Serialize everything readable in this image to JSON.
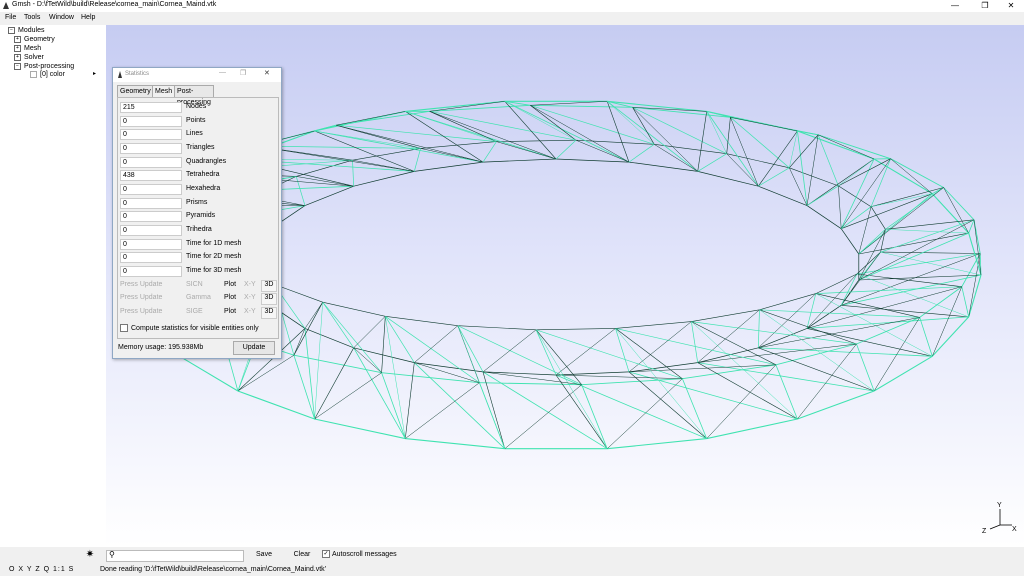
{
  "window": {
    "title": "Gmsh - D:\\fTetWild\\build\\Release\\cornea_main\\Cornea_Maind.vtk",
    "minimize": "—",
    "maximize": "❐",
    "close": "✕"
  },
  "menu": [
    "File",
    "Tools",
    "Window",
    "Help"
  ],
  "tree": {
    "root": "Modules",
    "items": [
      "Geometry",
      "Mesh",
      "Solver",
      "Post-processing"
    ],
    "sub": "[0] color"
  },
  "axes": {
    "x": "X",
    "y": "Y",
    "z": "Z"
  },
  "stats_dialog": {
    "title": "Statistics",
    "tabs": [
      "Geometry",
      "Mesh",
      "Post-processing"
    ],
    "active_tab": "Mesh",
    "rows": [
      {
        "value": "215",
        "label": "Nodes"
      },
      {
        "value": "0",
        "label": "Points"
      },
      {
        "value": "0",
        "label": "Lines"
      },
      {
        "value": "0",
        "label": "Triangles"
      },
      {
        "value": "0",
        "label": "Quadrangles"
      },
      {
        "value": "438",
        "label": "Tetrahedra"
      },
      {
        "value": "0",
        "label": "Hexahedra"
      },
      {
        "value": "0",
        "label": "Prisms"
      },
      {
        "value": "0",
        "label": "Pyramids"
      },
      {
        "value": "0",
        "label": "Trihedra"
      },
      {
        "value": "0",
        "label": "Time for 1D mesh"
      },
      {
        "value": "0",
        "label": "Time for 2D mesh"
      },
      {
        "value": "0",
        "label": "Time for 3D mesh"
      }
    ],
    "quality_rows": [
      {
        "press": "Press Update",
        "metric": "SICN",
        "plot": "Plot",
        "xy": "X-Y",
        "d3": "3D"
      },
      {
        "press": "Press Update",
        "metric": "Gamma",
        "plot": "Plot",
        "xy": "X-Y",
        "d3": "3D"
      },
      {
        "press": "Press Update",
        "metric": "SIGE",
        "plot": "Plot",
        "xy": "X-Y",
        "d3": "3D"
      }
    ],
    "checkbox_label": "Compute statistics for visible entities only",
    "memory": "Memory usage: 195.938Mb",
    "update": "Update"
  },
  "bottom": {
    "save": "Save",
    "clear": "Clear",
    "autoscroll": "Autoscroll messages",
    "status_buttons": "O X Y Z Q 1:1 S",
    "message": "Done reading 'D:\\fTetWild\\build\\Release\\cornea_main\\Cornea_Maind.vtk'"
  },
  "colors": {
    "mesh_light": "#3fe3b0",
    "mesh_dark": "#0f3b30",
    "viewport_top": "#c6ccf2"
  }
}
